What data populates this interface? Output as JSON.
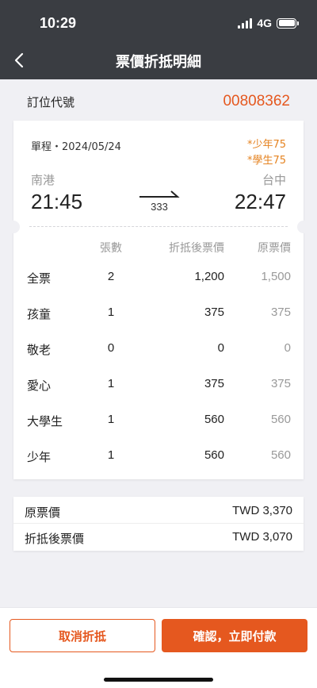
{
  "status_bar": {
    "time": "10:29",
    "network": "4G"
  },
  "header": {
    "title": "票價折抵明細"
  },
  "order": {
    "label": "訂位代號",
    "number": "00808362"
  },
  "trip": {
    "type_date": "單程・2024/05/24",
    "discounts": [
      "*少年75",
      "*學生75"
    ],
    "from_station": "南港",
    "to_station": "台中",
    "departure": "21:45",
    "arrival": "22:47",
    "train_no": "333"
  },
  "table": {
    "headers": {
      "count": "張數",
      "discounted": "折抵後票價",
      "original": "原票價"
    },
    "rows": [
      {
        "type": "全票",
        "count": "2",
        "discounted": "1,200",
        "original": "1,500"
      },
      {
        "type": "孩童",
        "count": "1",
        "discounted": "375",
        "original": "375"
      },
      {
        "type": "敬老",
        "count": "0",
        "discounted": "0",
        "original": "0"
      },
      {
        "type": "愛心",
        "count": "1",
        "discounted": "375",
        "original": "375"
      },
      {
        "type": "大學生",
        "count": "1",
        "discounted": "560",
        "original": "560"
      },
      {
        "type": "少年",
        "count": "1",
        "discounted": "560",
        "original": "560"
      }
    ]
  },
  "summary": {
    "original_label": "原票價",
    "original_value": "TWD 3,370",
    "discounted_label": "折抵後票價",
    "discounted_value": "TWD 3,070"
  },
  "buttons": {
    "cancel": "取消折抵",
    "confirm": "確認，立即付款"
  },
  "colors": {
    "accent": "#e5581f",
    "discount": "#e5821f",
    "topbar": "#3a3d42"
  }
}
